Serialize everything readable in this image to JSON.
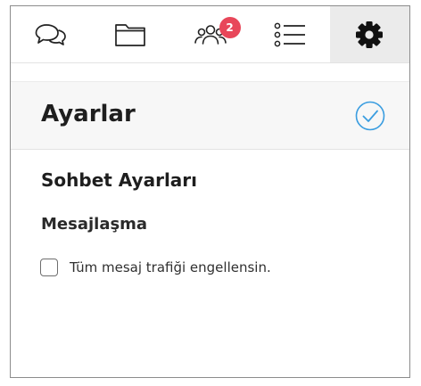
{
  "tabs": [
    {
      "icon": "chat-bubbles-icon",
      "active": false
    },
    {
      "icon": "folder-icon",
      "active": false
    },
    {
      "icon": "people-icon",
      "active": false,
      "badge": "2"
    },
    {
      "icon": "list-icon",
      "active": false
    },
    {
      "icon": "gear-icon",
      "active": true
    }
  ],
  "colors": {
    "badge": "#e8475a",
    "confirm_accent": "#3a9de0",
    "active_tab_bg": "#ebebeb",
    "header_bg": "#f7f7f7"
  },
  "header": {
    "title": "Ayarlar",
    "confirm_icon": "check-circle-icon"
  },
  "settings": {
    "section_title": "Sohbet Ayarları",
    "subsection_title": "Mesajlaşma",
    "options": [
      {
        "label": "Tüm mesaj trafiği engellensin.",
        "checked": false
      }
    ]
  }
}
